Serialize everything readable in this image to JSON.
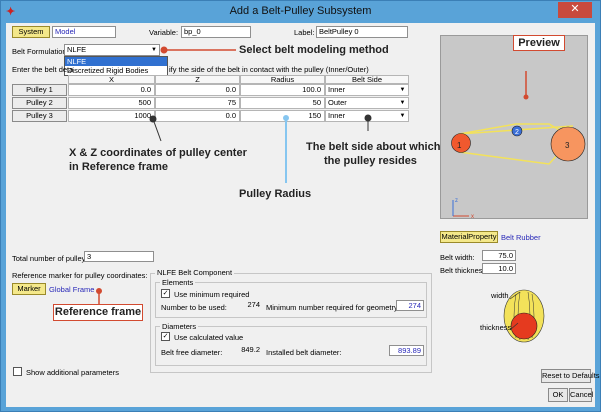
{
  "window": {
    "title": "Add a Belt-Pulley Subsystem",
    "close_label": "✕",
    "app_glyph": "✦"
  },
  "top": {
    "system_button": "System",
    "system_value": "Model",
    "variable_label": "Variable:",
    "variable_value": "bp_0",
    "label_label": "Label:",
    "label_value": "BeltPulley 0"
  },
  "formulation": {
    "label": "Belt Formulation:",
    "value": "NLFE",
    "options": [
      "NLFE",
      "Discretized Rigid Bodies"
    ],
    "instruction_left": "Enter the belt deta",
    "instruction_right": "ify the side of the belt in contact with the pulley (Inner/Outer)"
  },
  "pulley_table": {
    "headers": [
      "X",
      "Z",
      "Radius",
      "Belt Side"
    ],
    "rows": [
      {
        "name": "Pulley 1",
        "x": "0.0",
        "z": "0.0",
        "radius": "100.0",
        "side": "Inner"
      },
      {
        "name": "Pulley 2",
        "x": "500",
        "z": "75",
        "radius": "50",
        "side": "Outer"
      },
      {
        "name": "Pulley 3",
        "x": "1000",
        "z": "0.0",
        "radius": "150",
        "side": "Inner"
      }
    ]
  },
  "annotations": {
    "select_method": "Select belt modeling method",
    "preview": "Preview",
    "xz_coords_line1": "X & Z coordinates of pulley center",
    "xz_coords_line2": "in Reference frame",
    "belt_side_line1": "The belt side about which",
    "belt_side_line2": "the pulley resides",
    "pulley_radius": "Pulley Radius",
    "reference_frame": "Reference frame"
  },
  "preview": {
    "pulley_labels": [
      "1",
      "2",
      "3"
    ],
    "axis_z": "z",
    "axis_x": "x"
  },
  "material": {
    "button": "MaterialProperty",
    "value": "Belt Rubber",
    "width_label": "Belt width:",
    "width_value": "75.0",
    "thickness_label": "Belt thickness:",
    "thickness_value": "10.0",
    "diagram_width": "width",
    "diagram_thickness": "thickness"
  },
  "bottom_left": {
    "total_label": "Total number of pulleys:",
    "total_value": "3",
    "reference_label": "Reference marker for pulley coordinates:",
    "marker_button": "Marker",
    "marker_value": "Global Frame",
    "show_additional": "Show additional parameters"
  },
  "nlfe": {
    "group_title": "NLFE Belt Component",
    "elements_title": "Elements",
    "use_min_label": "Use minimum required",
    "use_min_checked": true,
    "number_used_label": "Number to be used:",
    "number_used_value": "274",
    "min_required_label": "Minimum number required for geometry:",
    "min_required_value": "274",
    "diameters_title": "Diameters",
    "use_calc_label": "Use calculated value",
    "use_calc_checked": true,
    "free_diam_label": "Belt free diameter:",
    "free_diam_value": "849.2",
    "installed_diam_label": "Installed belt diameter:",
    "installed_diam_value": "893.89"
  },
  "buttons": {
    "reset": "Reset to Defaults",
    "ok": "OK",
    "cancel": "Cancel"
  },
  "colors": {
    "accent_red": "#d24a30",
    "preview_bg": "#c8c8c8",
    "pulley_fill": "#f0592e",
    "belt": "#f3e25a",
    "radius_line": "#86c6f0"
  }
}
